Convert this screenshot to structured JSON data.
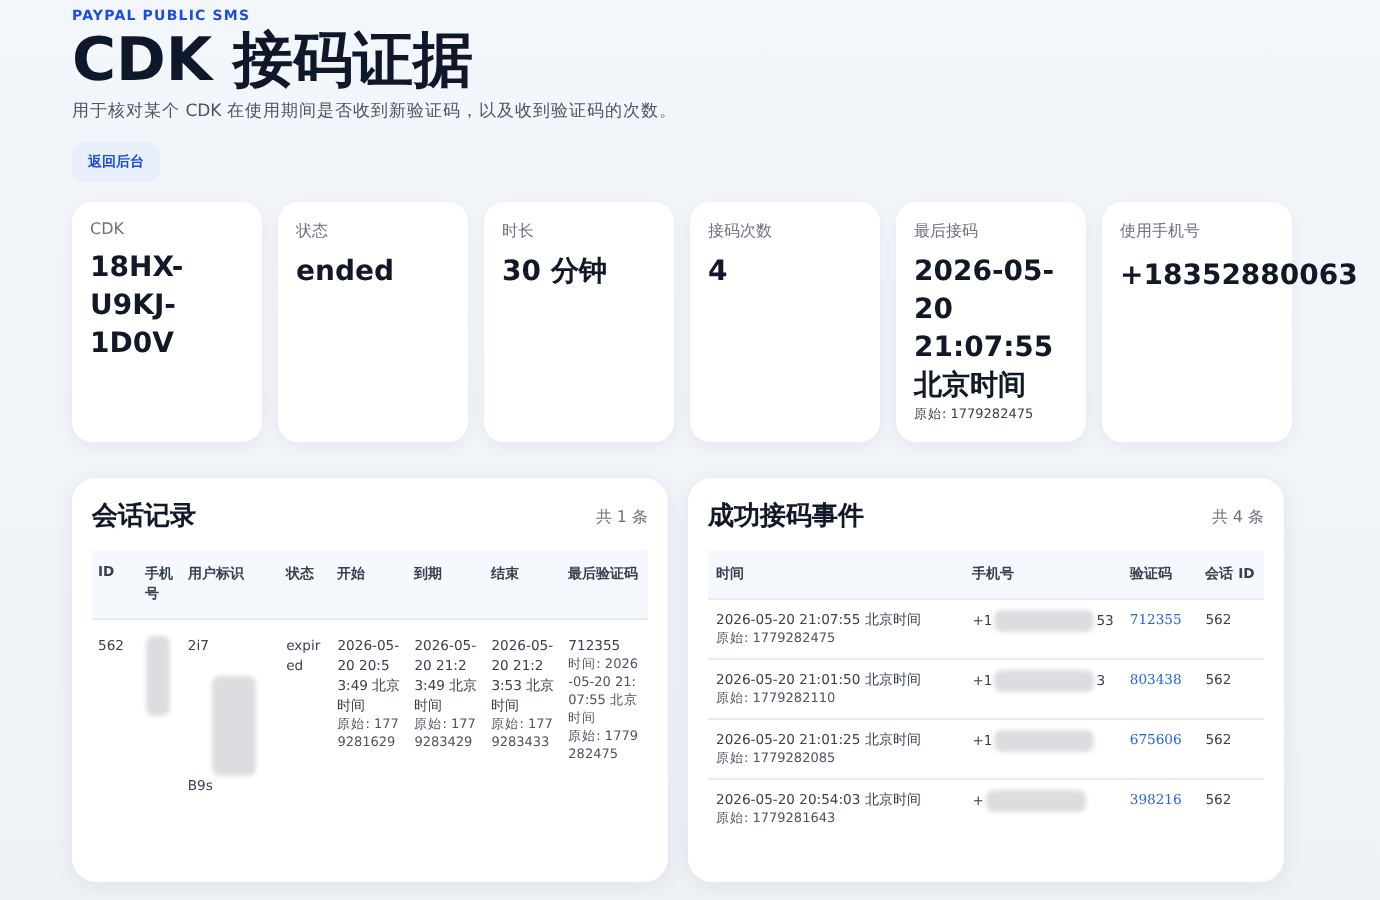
{
  "header": {
    "eyebrow": "PAYPAL PUBLIC SMS",
    "title": "CDK 接码证据",
    "subtitle": "用于核对某个 CDK 在使用期间是否收到新验证码，以及收到验证码的次数。",
    "back_button": "返回后台"
  },
  "stats": [
    {
      "label": "CDK",
      "value": "18HX-U9KJ-1D0V"
    },
    {
      "label": "状态",
      "value": "ended"
    },
    {
      "label": "时长",
      "value": "30 分钟"
    },
    {
      "label": "接码次数",
      "value": "4"
    },
    {
      "label": "最后接码",
      "value": "2026-05-20 21:07:55 北京时间",
      "raw": "原始: 1779282475"
    },
    {
      "label": "使用手机号",
      "value": "+18352880063"
    }
  ],
  "sessions": {
    "title": "会话记录",
    "count": "共 1 条",
    "columns": [
      "ID",
      "手机号",
      "用户标识",
      "状态",
      "开始",
      "到期",
      "结束",
      "最后验证码"
    ],
    "rows": [
      {
        "id": "562",
        "user_id_start": "2i7",
        "user_id_end": "B9s",
        "status": "expired",
        "start": {
          "time": "2026-05-20 20:53:49 北京时间",
          "raw": "原始: 1779281629"
        },
        "expires": {
          "time": "2026-05-20 21:23:49 北京时间",
          "raw": "原始: 1779283429"
        },
        "ended": {
          "time": "2026-05-20 21:23:53 北京时间",
          "raw": "原始: 1779283433"
        },
        "last_code": {
          "code": "712355",
          "time": "时间: 2026-05-20 21:07:55 北京时间",
          "raw": "原始: 1779282475"
        }
      }
    ]
  },
  "events": {
    "title": "成功接码事件",
    "count": "共 4 条",
    "columns": [
      "时间",
      "手机号",
      "验证码",
      "会话 ID"
    ],
    "rows": [
      {
        "time": "2026-05-20 21:07:55 北京时间",
        "raw": "原始: 1779282475",
        "phone_start": "+1",
        "phone_end": "53",
        "code": "712355",
        "session": "562"
      },
      {
        "time": "2026-05-20 21:01:50 北京时间",
        "raw": "原始: 1779282110",
        "phone_start": "+1",
        "phone_end": "3",
        "code": "803438",
        "session": "562"
      },
      {
        "time": "2026-05-20 21:01:25 北京时间",
        "raw": "原始: 1779282085",
        "phone_start": "+1",
        "code": "675606",
        "session": "562"
      },
      {
        "time": "2026-05-20 20:54:03 北京时间",
        "raw": "原始: 1779281643",
        "phone_start": "+",
        "code": "398216",
        "session": "562"
      }
    ]
  }
}
